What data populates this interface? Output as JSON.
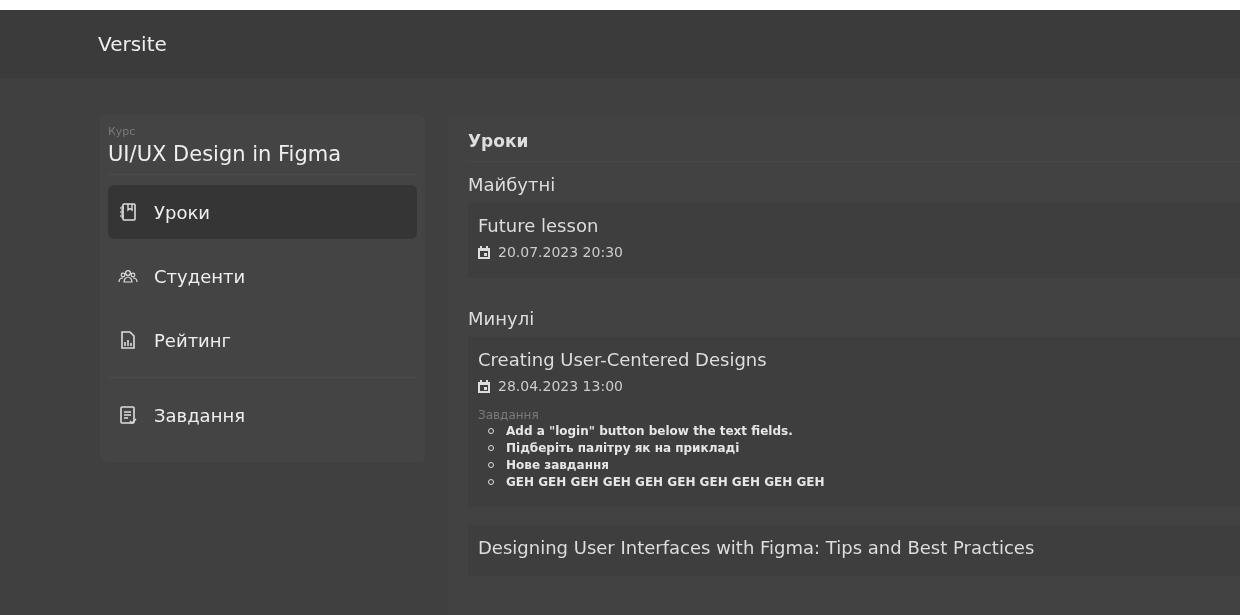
{
  "header": {
    "brand": "Versite"
  },
  "sidebar": {
    "course_label": "Курс",
    "course_title": "UI/UX Design in Figma",
    "groups": [
      [
        {
          "label": "Уроки",
          "kind": "lessons",
          "selected": true
        },
        {
          "label": "Студенти",
          "kind": "students",
          "selected": false
        },
        {
          "label": "Рейтинг",
          "kind": "rating",
          "selected": false
        }
      ],
      [
        {
          "label": "Завдання",
          "kind": "tasks",
          "selected": false
        }
      ]
    ]
  },
  "main": {
    "title": "Уроки",
    "sections": [
      {
        "title": "Майбутні",
        "lessons": [
          {
            "title": "Future lesson",
            "date": "20.07.2023 20:30"
          }
        ]
      },
      {
        "title": "Минулі",
        "lessons": [
          {
            "title": "Creating User-Centered Designs",
            "date": "28.04.2023 13:00",
            "tasks_label": "Завдання",
            "tasks": [
              "Add a \"login\" button below the text fields.",
              "Підберіть палітру як на прикладі",
              "Нове завдання",
              "GEH GEH GEH GEH GEH GEH GEH GEH GEH GEH"
            ]
          },
          {
            "title": "Designing User Interfaces with Figma: Tips and Best Practices"
          }
        ]
      }
    ]
  }
}
